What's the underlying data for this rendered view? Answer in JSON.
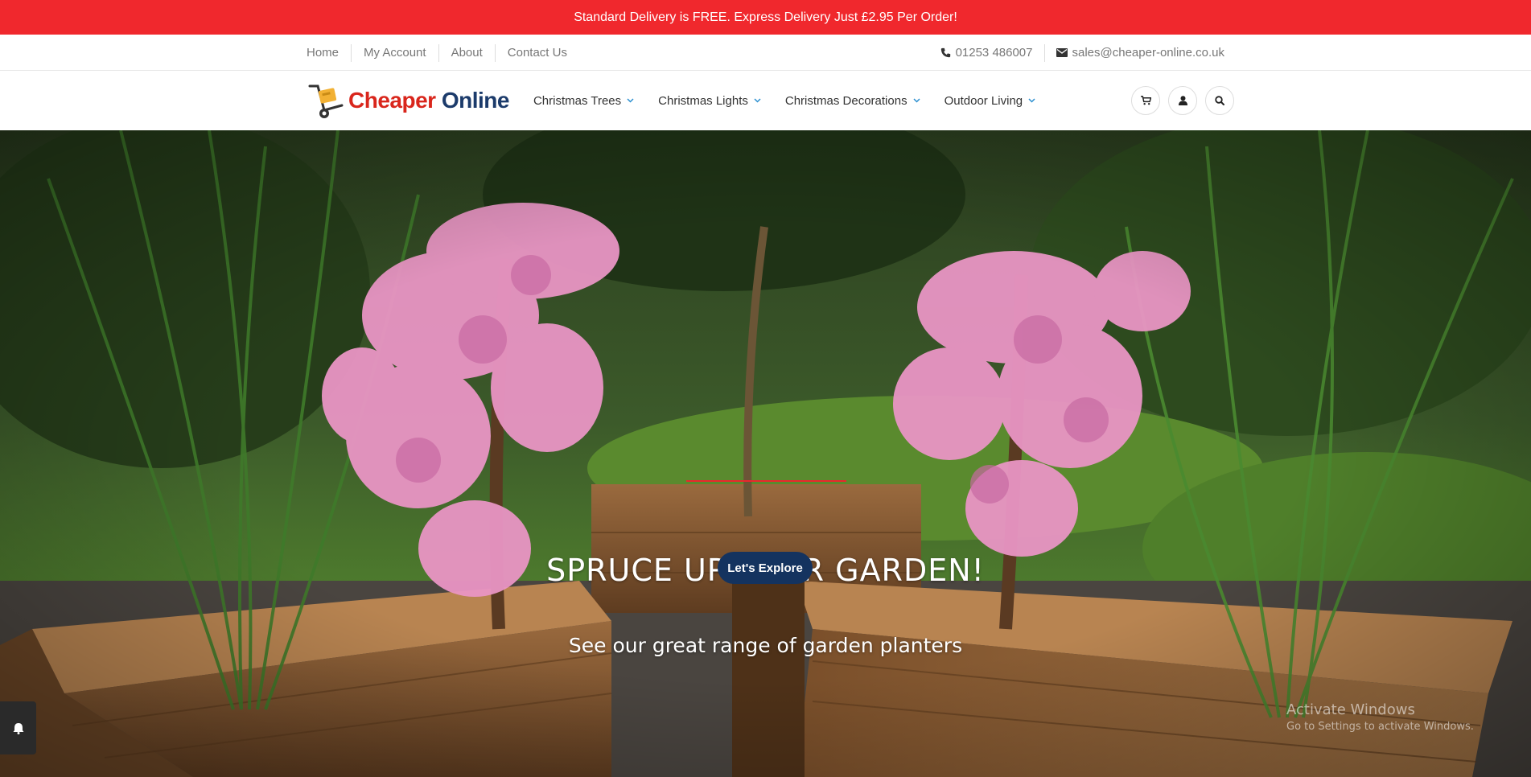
{
  "announcement": "Standard Delivery is FREE. Express Delivery Just £2.95 Per Order!",
  "utility": {
    "links": [
      "Home",
      "My Account",
      "About",
      "Contact Us"
    ],
    "phone": "01253 486007",
    "email": "sales@cheaper-online.co.uk"
  },
  "logo": {
    "part1": "Cheaper",
    "part2": "Online"
  },
  "nav": [
    {
      "label": "Christmas Trees"
    },
    {
      "label": "Christmas Lights"
    },
    {
      "label": "Christmas Decorations"
    },
    {
      "label": "Outdoor Living"
    }
  ],
  "hero": {
    "title": "SPRUCE UP YOUR GARDEN!",
    "subtitle": "See our great range of garden planters",
    "button": "Let's Explore"
  },
  "watermark": {
    "line1": "Activate Windows",
    "line2": "Go to Settings to activate Windows."
  },
  "colors": {
    "announce_bg": "#f0282d",
    "button_bg": "#14335f",
    "accent_rule": "#e8282d"
  }
}
